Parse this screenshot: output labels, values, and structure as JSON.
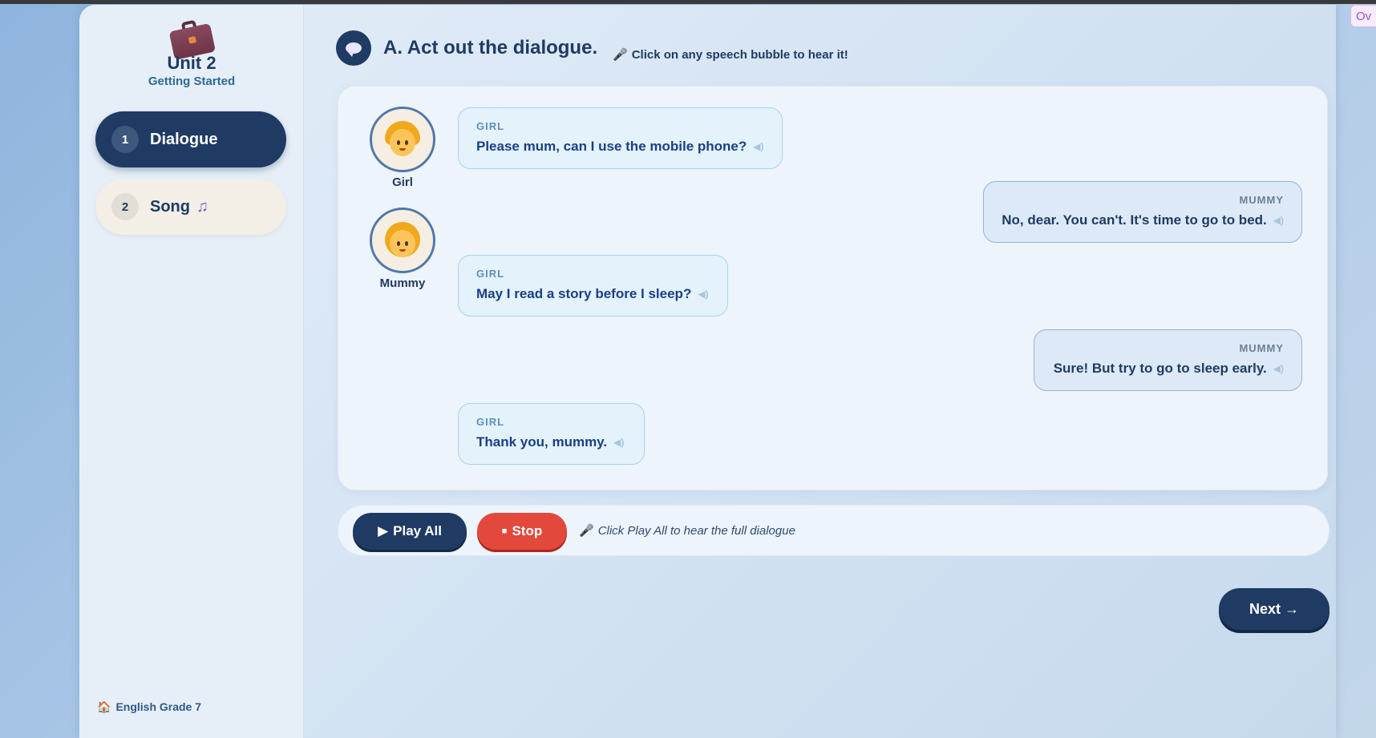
{
  "corner_tab": {
    "label": "Ov"
  },
  "sidebar": {
    "unit_title": "Unit 2",
    "unit_subtitle": "Getting Started",
    "items": [
      {
        "number": "1",
        "label": "Dialogue",
        "active": true
      },
      {
        "number": "2",
        "label": "Song",
        "icon": "music-note-icon",
        "active": false
      }
    ],
    "footer": {
      "icon": "house-icon",
      "label": "English Grade 7"
    }
  },
  "section": {
    "icon": "speech-bubble-icon",
    "title": "A. Act out the dialogue.",
    "hint_icon": "microphone-icon",
    "hint": "Click on any speech bubble to hear it!"
  },
  "characters": [
    {
      "name": "Girl",
      "icon": "girl-emoji-icon"
    },
    {
      "name": "Mummy",
      "icon": "mother-emoji-icon"
    }
  ],
  "dialogue": [
    {
      "speaker": "GIRL",
      "text": "Please mum, can I use the mobile phone?"
    },
    {
      "speaker": "MUMMY",
      "text": "No, dear. You can't. It's time to go to bed."
    },
    {
      "speaker": "GIRL",
      "text": "May I read a story before I sleep?"
    },
    {
      "speaker": "MUMMY",
      "text": "Sure! But try to go to sleep early."
    },
    {
      "speaker": "GIRL",
      "text": "Thank you, mummy."
    }
  ],
  "controls": {
    "play_label": "Play All",
    "stop_label": "Stop",
    "hint_icon": "microphone-icon",
    "hint": "Click Play All to hear the full dialogue"
  },
  "next_label": "Next →",
  "colors": {
    "primary": "#1f3b63",
    "stop": "#e2483b",
    "girl_bubble": "#e4f2fc",
    "mummy_bubble": "#dde9f6"
  }
}
